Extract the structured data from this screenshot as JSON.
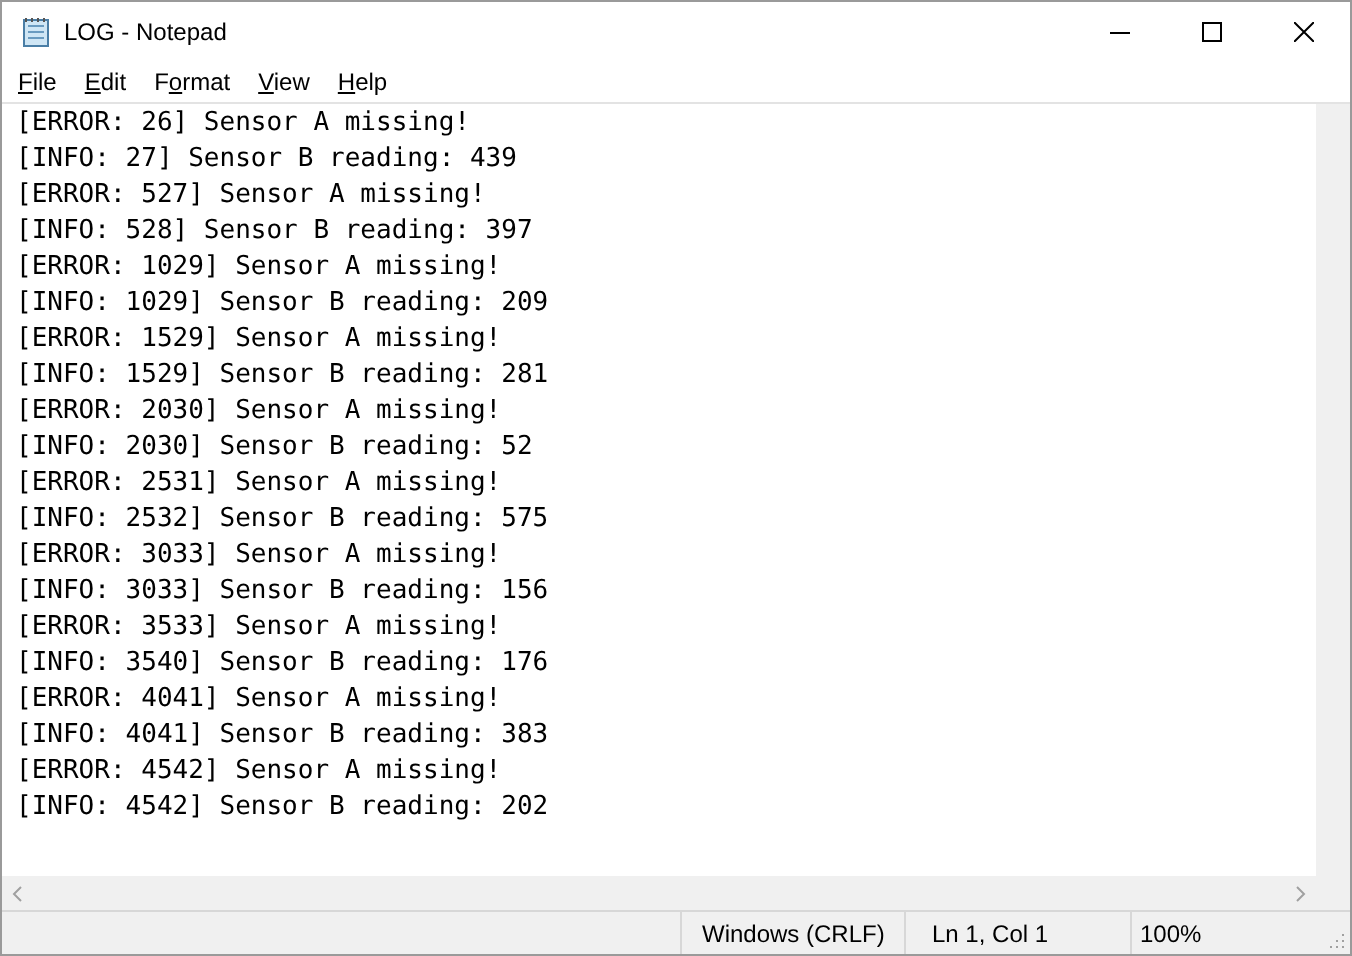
{
  "window": {
    "title": "LOG - Notepad"
  },
  "menu": [
    {
      "access_key": "F",
      "label_rest": "ile"
    },
    {
      "access_key": "E",
      "label_rest": "dit"
    },
    {
      "label_start": "F",
      "access_key": "o",
      "label_rest": "rmat"
    },
    {
      "access_key": "V",
      "label_rest": "iew"
    },
    {
      "access_key": "H",
      "label_rest": "elp"
    }
  ],
  "lines": [
    "[ERROR: 26] Sensor A missing!",
    "[INFO: 27] Sensor B reading: 439",
    "[ERROR: 527] Sensor A missing!",
    "[INFO: 528] Sensor B reading: 397",
    "[ERROR: 1029] Sensor A missing!",
    "[INFO: 1029] Sensor B reading: 209",
    "[ERROR: 1529] Sensor A missing!",
    "[INFO: 1529] Sensor B reading: 281",
    "[ERROR: 2030] Sensor A missing!",
    "[INFO: 2030] Sensor B reading: 52",
    "[ERROR: 2531] Sensor A missing!",
    "[INFO: 2532] Sensor B reading: 575",
    "[ERROR: 3033] Sensor A missing!",
    "[INFO: 3033] Sensor B reading: 156",
    "[ERROR: 3533] Sensor A missing!",
    "[INFO: 3540] Sensor B reading: 176",
    "[ERROR: 4041] Sensor A missing!",
    "[INFO: 4041] Sensor B reading: 383",
    "[ERROR: 4542] Sensor A missing!",
    "[INFO: 4542] Sensor B reading: 202"
  ],
  "status_bar": {
    "line_ending": "Windows (CRLF)",
    "position": "Ln 1, Col 1",
    "zoom": "100%"
  }
}
